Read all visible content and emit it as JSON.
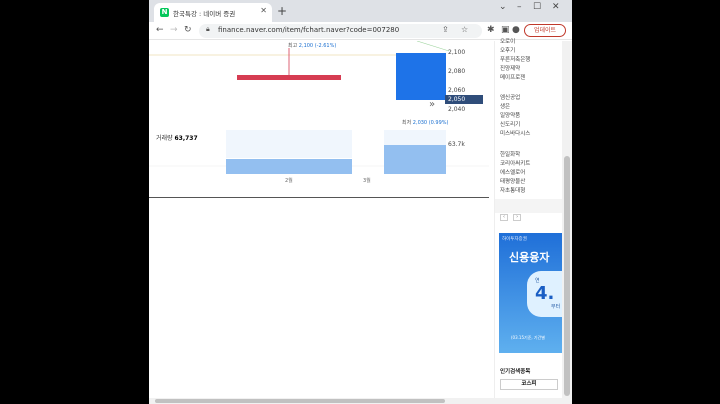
{
  "browser": {
    "tab_title": "한국특강 : 네이버 증권",
    "favicon_letter": "N",
    "url": "finance.naver.com/item/fchart.naver?code=007280",
    "update_label": "업데이트",
    "icons": [
      "back-icon",
      "forward-icon",
      "refresh-icon",
      "lock-icon",
      "share-icon",
      "star-icon",
      "extension-icon",
      "sidepanel-icon",
      "profile-icon",
      "menu-icon"
    ]
  },
  "chart": {
    "high_annotation_prefix": "최고 ",
    "high_annotation_value": "2,100 (-2.61%)",
    "low_annotation_prefix": "최저 ",
    "low_annotation_value": "2,030 (0.99%)",
    "volume_prefix": "거래량 ",
    "volume_value": "63,737",
    "current_price": "2,050",
    "vol_max_label": "63.7k",
    "month_labels": [
      "2월",
      "3월"
    ],
    "colors": {
      "down": "#d63c52",
      "up": "#1e73e8",
      "volume": "#93bff0",
      "price_tag": "#2f4d7a"
    }
  },
  "chart_data": {
    "type": "candlestick",
    "y_ticks": [
      "2,100",
      "2,080",
      "2,060",
      "2,040"
    ],
    "current_price": 2050,
    "volume": 63737
  },
  "sidebar": {
    "stocks_a": [
      "오로이",
      "오후기",
      "푸른저축은행",
      "진양제약",
      "메이프로젠"
    ],
    "stocks_b": [
      "엠신공업",
      "생은",
      "일양약품",
      "신도리기",
      "미스바다시스"
    ],
    "stocks_c": [
      "한일화학",
      "코리아써키트",
      "에스엘로어",
      "태평양물산",
      "자초통대형"
    ],
    "pager_prev": "‹",
    "pager_next": "›",
    "ad_brand": "하이투자증권",
    "ad_title": "신용융자",
    "ad_rate_label": "연",
    "ad_rate": "4.",
    "ad_rate_sub": "부터",
    "ad_foot": "(03.15기준, 기간별",
    "popular_title": "인기검색종목",
    "kospi_tab": "코스피"
  }
}
